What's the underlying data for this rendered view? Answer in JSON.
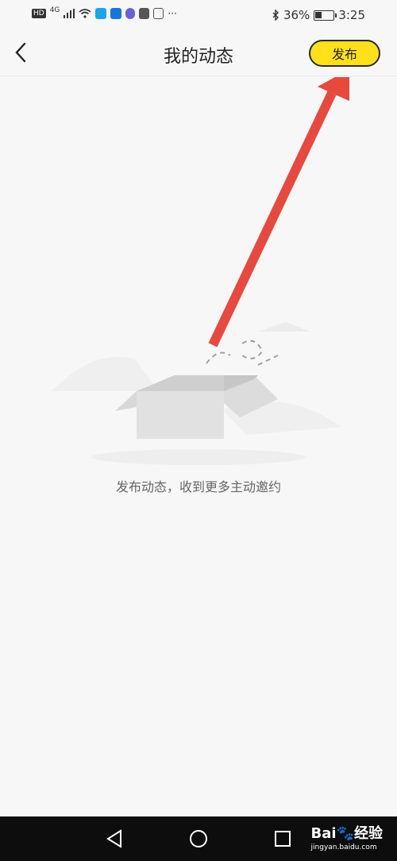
{
  "status_bar": {
    "icons": [
      "hd-icon",
      "signal-4g-icon",
      "wifi-icon",
      "app-search-icon",
      "app-cloud-icon",
      "app-music-icon",
      "app-bag-icon",
      "app-hand-icon",
      "more-dots-icon",
      "bluetooth-icon",
      "battery-icon"
    ],
    "hd_label": "HD",
    "network_label": "4G",
    "more": "···",
    "battery_percent": "36%",
    "battery_level": 0.36,
    "time": "3:25"
  },
  "nav": {
    "back_icon": "chevron-left-icon",
    "title": "我的动态",
    "publish_label": "发布",
    "publish_color": "#ffe01b"
  },
  "empty_state": {
    "illustration": "open-box-illustration",
    "message": "发布动态，收到更多主动邀约"
  },
  "annotation": {
    "arrow_color": "#e8493f",
    "description_icon": "red-arrow-icon"
  },
  "system_nav": {
    "back_icon": "triangle-back-icon",
    "home_icon": "circle-home-icon",
    "recent_icon": "square-recent-icon"
  },
  "watermark": {
    "brand": "Bai",
    "brand_cn": "经验",
    "url": "jingyan.baidu.com"
  }
}
